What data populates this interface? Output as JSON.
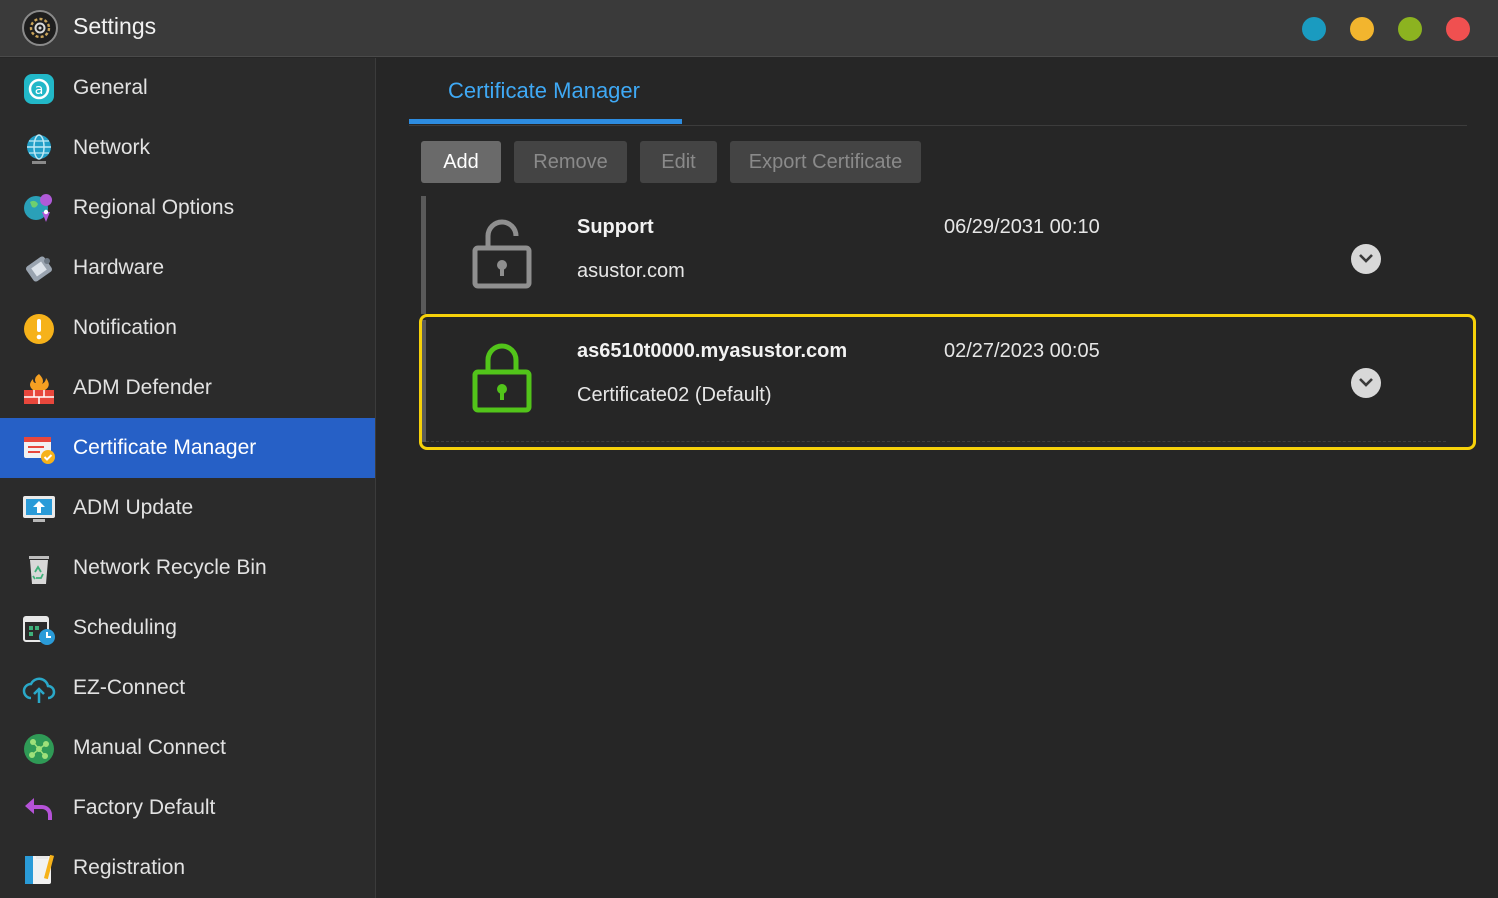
{
  "window": {
    "title": "Settings",
    "icon": "gear-icon",
    "controls": [
      {
        "name": "window-minimize-dot",
        "color": "#1a9bc0"
      },
      {
        "name": "window-restore-dot",
        "color": "#f2b52e"
      },
      {
        "name": "window-maximize-dot",
        "color": "#8cb320"
      },
      {
        "name": "window-close-dot",
        "color": "#f05050"
      }
    ]
  },
  "sidebar": {
    "items": [
      {
        "label": "General",
        "icon": "general-icon",
        "active": false
      },
      {
        "label": "Network",
        "icon": "globe-icon",
        "active": false
      },
      {
        "label": "Regional Options",
        "icon": "regional-globe-pin-icon",
        "active": false
      },
      {
        "label": "Hardware",
        "icon": "hardware-icon",
        "active": false
      },
      {
        "label": "Notification",
        "icon": "notification-exclamation-icon",
        "active": false
      },
      {
        "label": "ADM Defender",
        "icon": "firewall-icon",
        "active": false
      },
      {
        "label": "Certificate Manager",
        "icon": "certificate-icon",
        "active": true
      },
      {
        "label": "ADM Update",
        "icon": "update-monitor-icon",
        "active": false
      },
      {
        "label": "Network Recycle Bin",
        "icon": "recycle-bin-icon",
        "active": false
      },
      {
        "label": "Scheduling",
        "icon": "calendar-clock-icon",
        "active": false
      },
      {
        "label": "EZ-Connect",
        "icon": "cloud-upload-icon",
        "active": false
      },
      {
        "label": "Manual Connect",
        "icon": "network-nodes-icon",
        "active": false
      },
      {
        "label": "Factory Default",
        "icon": "undo-arrow-icon",
        "active": false
      },
      {
        "label": "Registration",
        "icon": "registration-card-icon",
        "active": false
      }
    ]
  },
  "main": {
    "tab": {
      "label": "Certificate Manager"
    },
    "toolbar": {
      "add_label": "Add",
      "remove_label": "Remove",
      "edit_label": "Edit",
      "export_label": "Export Certificate"
    },
    "certificates": [
      {
        "name": "Support",
        "subtitle": "asustor.com",
        "expires": "06/29/2031 00:10",
        "lock_icon": "unlocked-padlock-icon",
        "lock_color": "#8f8f8f"
      },
      {
        "name": "as6510t0000.myasustor.com",
        "subtitle": "Certificate02 (Default)",
        "expires": "02/27/2023 00:05",
        "lock_icon": "locked-padlock-icon",
        "lock_color": "#52c41a",
        "highlighted": true
      }
    ]
  },
  "colors": {
    "accent": "#2d8ce0",
    "active_nav": "#2660c6",
    "highlight": "#f6d10a"
  }
}
